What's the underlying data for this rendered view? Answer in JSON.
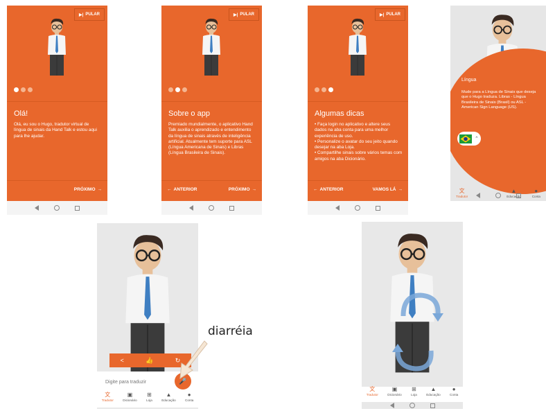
{
  "screens": {
    "s1": {
      "skip": "PULAR",
      "title": "Olá!",
      "body": "Olá, eu sou o Hugo, tradutor virtual de língua de sinais da Hand Talk e estou aqui para lhe ajudar.",
      "next": "PRÓXIMO"
    },
    "s2": {
      "skip": "PULAR",
      "title": "Sobre o app",
      "body": "Premiado mundialmente, o aplicativo Hand Talk auxilia o aprendizado e entendimento da língua de sinais através de inteligência artificial. Atualmente tem suporte para ASL (Língua Americana de Sinais) e Libras (Língua Brasileira de Sinais).",
      "prev": "ANTERIOR",
      "next": "PRÓXIMO"
    },
    "s3": {
      "skip": "PULAR",
      "title": "Algumas dicas",
      "body": "• Faça login no aplicativo e altere seus dados na aba conta para uma melhor experiência de uso.\n• Personalize o avatar do seu jeito quando desejar na aba Loja.\n• Compartilhe sinais sobre vários temas com amigos na aba Dicionário.",
      "prev": "ANTERIOR",
      "next": "VAMOS LÁ"
    },
    "s4": {
      "title": "Língua",
      "body": "Mude para a Língua de Sinais que deseja que o Hugo traduza. Libras - Língua Brasileira de Sinais (Brasil) ou ASL - American Sign Language (US).",
      "tab_translator": "Tradutor",
      "tab_education": "Educação",
      "tab_account": "Conta"
    },
    "s5": {
      "placeholder": "Digite para traduzir",
      "annotation": "diarréia"
    }
  },
  "tabs": [
    "Tradutor",
    "Dicionário",
    "Loja",
    "Educação",
    "Conta"
  ],
  "colors": {
    "brand": "#e8672c",
    "flag_green": "#1a9a3a",
    "flag_yellow": "#f4d20a",
    "flag_blue": "#1e3b8a"
  }
}
